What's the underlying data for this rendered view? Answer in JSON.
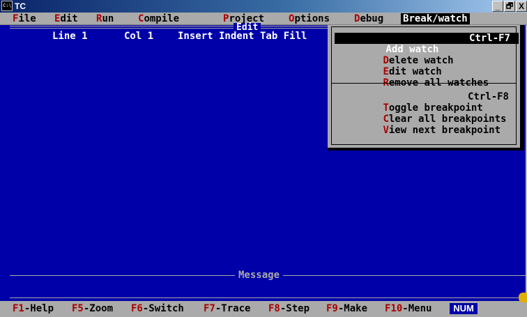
{
  "window": {
    "title": "TC",
    "icon": "msdos-icon",
    "icon_glyph": "C:\\",
    "min_symbol": "_",
    "max_symbol": "à",
    "close_symbol": "X"
  },
  "menubar": {
    "items": [
      {
        "hot": "F",
        "rest": "ile"
      },
      {
        "hot": "E",
        "rest": "dit"
      },
      {
        "hot": "R",
        "rest": "un"
      },
      {
        "hot": "C",
        "rest": "ompile"
      },
      {
        "hot": "P",
        "rest": "roject"
      },
      {
        "hot": "O",
        "rest": "ptions"
      },
      {
        "hot": "D",
        "rest": "ebug"
      },
      {
        "hot": "B",
        "rest": "reak/watch"
      }
    ],
    "active_index": 7
  },
  "editor": {
    "title": "Edit",
    "line": "Line 1",
    "col": "Col 1",
    "flags": "Insert Indent Tab Fill"
  },
  "message": {
    "title": "Message"
  },
  "dropdown": {
    "items": [
      {
        "hot": "A",
        "rest": "dd watch",
        "shortcut": "Ctrl-F7",
        "selected": true
      },
      {
        "hot": "D",
        "rest": "elete watch",
        "shortcut": ""
      },
      {
        "hot": "E",
        "rest": "dit watch",
        "shortcut": ""
      },
      {
        "hot": "R",
        "rest": "emove all watches",
        "shortcut": ""
      },
      {
        "hot": "T",
        "rest": "oggle breakpoint",
        "shortcut": "Ctrl-F8"
      },
      {
        "hot": "C",
        "rest": "lear all breakpoints",
        "shortcut": ""
      },
      {
        "hot": "V",
        "rest": "iew next breakpoint",
        "shortcut": ""
      }
    ]
  },
  "fnbar": {
    "items": [
      {
        "key": "F1",
        "label": "-Help"
      },
      {
        "key": "F5",
        "label": "-Zoom"
      },
      {
        "key": "F6",
        "label": "-Switch"
      },
      {
        "key": "F7",
        "label": "-Trace"
      },
      {
        "key": "F8",
        "label": "-Step"
      },
      {
        "key": "F9",
        "label": "-Make"
      },
      {
        "key": "F10",
        "label": "-Menu"
      }
    ],
    "num_indicator": "NUM"
  },
  "colors": {
    "background": "#0000a8",
    "menu_gray": "#aaaaaa",
    "hotkey_red": "#a80000",
    "text_white": "#ffffff"
  }
}
